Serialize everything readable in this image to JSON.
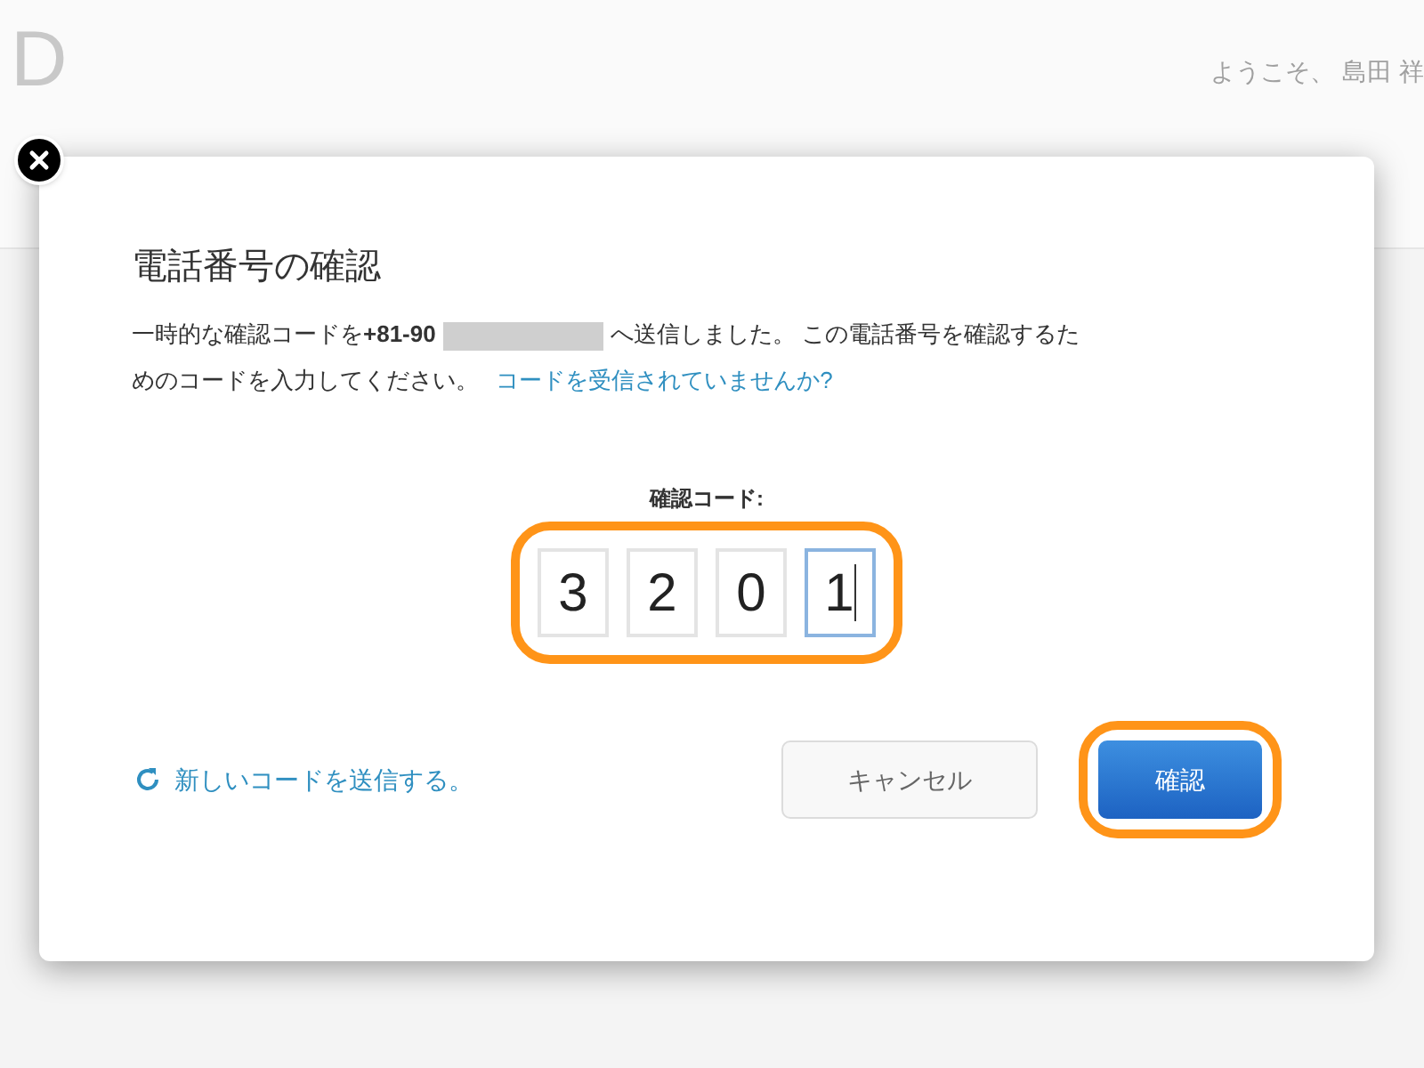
{
  "header": {
    "logo": "D",
    "welcome": "ようこそ、 島田 祥"
  },
  "dialog": {
    "title": "電話番号の確認",
    "message_start": "一時的な確認コードを**+81-90**",
    "phone_redacted": true,
    "message_end": "へ送信しました。 この電話番号を確認するためのコードを入力してください。",
    "help_link": "コードを受信されていませんか?",
    "code_label": "確認コード:",
    "code_highlighted": true,
    "code_digits": [
      {
        "value": "3",
        "focused": false
      },
      {
        "value": "2",
        "focused": false
      },
      {
        "value": "0",
        "focused": false
      },
      {
        "value": "1",
        "focused": true
      }
    ],
    "resend_link": "新しいコードを送信する。",
    "buttons": [
      {
        "label": "キャンセル",
        "kind": "secondary",
        "highlighted": false
      },
      {
        "label": "確認",
        "kind": "primary",
        "highlighted": true
      }
    ]
  }
}
